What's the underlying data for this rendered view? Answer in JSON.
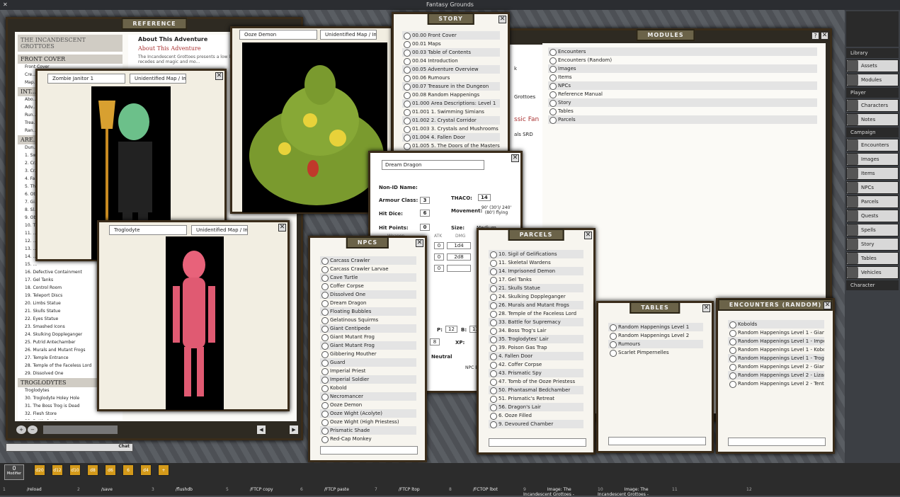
{
  "app": {
    "title": "Fantasy Grounds"
  },
  "reference": {
    "title": "Reference",
    "book_title": "The Incandescent Grottoes",
    "front_cover": "Front Cover",
    "front_items": [
      "Front Cover",
      "Cre...",
      "Map..."
    ],
    "about_title": "About This Adventure",
    "about_sub": "About This Adventure",
    "about_text": "The Incandescent Grottoes presents a low level surface world's logic recedes and magic and mo...",
    "section_int": "Int...",
    "int_items": [
      "Abo...",
      "Adv...",
      "Run...",
      "Trea...",
      "Ran..."
    ],
    "section_are": "Are...",
    "are_items": [
      "Dun...",
      "1. Sw...",
      "2. Cr...",
      "3. Cr...",
      "4. Fa...",
      "5. Th...",
      "6. Ot...",
      "7. Gi...",
      "8. Sl...",
      "9. Ob...",
      "10. T...",
      "11. ...",
      "12. ...",
      "13. ...",
      "14. ...",
      "15. ..."
    ],
    "more_items": [
      "16. Defective Containment",
      "17. Gel Tanks",
      "18. Control Room",
      "19. Teleport Discs",
      "20. Limbs Statue",
      "21. Skulls Statue",
      "22. Eyes Statue",
      "23. Smashed Icons",
      "24. Skulking Doppleganger",
      "25. Putrid Antechamber",
      "26. Murals and Mutant Frogs",
      "27. Temple Entrance",
      "28. Temple of the Faceless Lord",
      "29. Dissolved One"
    ],
    "section_trog": "Troglodytes",
    "trog_items": [
      "Troglodytes",
      "30. Troglodyte Holey Hole",
      "31. The Boss Trog is Dead",
      "32. Flesh Store",
      "33. Bottle for Supremacy"
    ]
  },
  "zombie": {
    "name": "Zombie Janitor 1",
    "image": "Unidentified Map / Imag"
  },
  "trog": {
    "name": "Troglodyte",
    "image": "Unidentified Map / Imag"
  },
  "ooze": {
    "name": "Ooze Demon",
    "image": "Unidentified Map / Imag"
  },
  "story": {
    "title": "Story",
    "items": [
      "00.00 Front Cover",
      "00.01 Maps",
      "00.03 Table of Contents",
      "00.04 Introduction",
      "00.05 Adventure Overview",
      "00.06 Rumours",
      "00.07 Treasure in the Dungeon",
      "00.08 Random Happenings",
      "01.000 Area Descriptions: Level 1",
      "01.001 1. Swimming Simians",
      "01.002 2. Crystal Corridor",
      "01.003 3. Crystals and Mushrooms",
      "01.004 4. Fallen Door",
      "01.005 5. The Doors of the Masters"
    ]
  },
  "modules": {
    "title": "Modules",
    "items": [
      "Encounters",
      "Encounters (Random)",
      "Images",
      "Items",
      "NPCs",
      "Reference Manual",
      "Story",
      "Tables",
      "Parcels"
    ],
    "peek": [
      "k",
      "Grottoes",
      "ssic Fan",
      "als SRD"
    ]
  },
  "npc_sheet": {
    "name": "Dream Dragon",
    "nonid_label": "Non-ID Name:",
    "ac_label": "Armour Class:",
    "ac": "3",
    "thaco_label": "THACO:",
    "thaco": "14",
    "hd_label": "Hit Dice:",
    "hd": "6",
    "move_label": "Movement:",
    "move": "90' (30')/ 240' (80') flying",
    "hp_label": "Hit Points:",
    "hp": "0",
    "size_label": "Size:",
    "size": "Medium",
    "weapon_label": "Weapon",
    "atk_label": "ATK",
    "dmg_label": "DMG",
    "atk1": "0",
    "dmg1": "1d4",
    "atk2": "0",
    "dmg2": "2d8",
    "atk3": "0",
    "p_label": "P:",
    "p": "12",
    "b_label": "B:",
    "b": "13",
    "xp_label": "XP:",
    "lvl": "8",
    "align": "Neutral",
    "npc_label": "NPC Ef"
  },
  "npcs": {
    "title": "NPCs",
    "items": [
      "Carcass Crawler",
      "Carcass Crawler Larvae",
      "Cave Turtle",
      "Coffer Corpse",
      "Dissolved One",
      "Dream Dragon",
      "Floating Bubbles",
      "Gelatinous Squirms",
      "Giant Centipede",
      "Giant Mutant Frog",
      "Giant Mutant Frog",
      "Gibbering Mouther",
      "Guard",
      "Imperial Priest",
      "Imperial Soldier",
      "Kobold",
      "Necromancer",
      "Ooze Demon",
      "Ooze Wight (Acolyte)",
      "Ooze Wight (High Priestess)",
      "Prismatic Shade",
      "Red-Cap Monkey"
    ]
  },
  "parcels": {
    "title": "Parcels",
    "items": [
      "10. Sigil of Gelifications",
      "11. Skeletal Wardens",
      "14. Imprisoned Demon",
      "17. Gel Tanks",
      "21. Skulls Statue",
      "24. Skulking Doppleganger",
      "26. Murals and Mutant Frogs",
      "28. Temple of the Faceless Lord",
      "33. Battle for Supremacy",
      "34. Boss Trog's Lair",
      "35. Troglodytes' Lair",
      "39. Poison Gas Trap",
      "4. Fallen Door",
      "42. Coffer Corpse",
      "43. Prismatic Spy",
      "47. Tomb of the Ooze Priestess",
      "50. Phantasmal Bedchamber",
      "51. Prismatic's Retreat",
      "56. Dragon's Lair",
      "6. Ooze Filled",
      "9. Devoured Chamber"
    ]
  },
  "tables": {
    "title": "Tables",
    "items": [
      "Random Happenings Level 1",
      "Random Happenings Level 2",
      "Rumours",
      "Scarlet Pimpernelles"
    ]
  },
  "encounters": {
    "title": "Encounters (Random)",
    "items": [
      "Kobolds",
      "Random Happenings Level 1 - Giant Centiped",
      "Random Happenings Level 1 - Imperial Soldie",
      "Random Happenings Level 1 - Kobolds",
      "Random Happenings Level 1 - Troglodytes",
      "Random Happenings Level 2 - Giant Mutant F",
      "Random Happenings Level 2 - Lizard Men",
      "Random Happenings Level 2 - Tentacles"
    ]
  },
  "sidebar": {
    "library": "Library",
    "assets": "Assets",
    "modules": "Modules",
    "player": "Player",
    "characters": "Characters",
    "notes": "Notes",
    "campaign": "Campaign",
    "campaign_items": [
      "Encounters",
      "Images",
      "Items",
      "NPCs",
      "Parcels",
      "Quests",
      "Spells",
      "Story",
      "Tables",
      "Vehicles"
    ],
    "character": "Character"
  },
  "chat": {
    "label": "Chat",
    "modifier": "0",
    "modifier_label": "Modifier"
  },
  "dice": [
    "d20",
    "d12",
    "d10",
    "d8",
    "d6",
    "6",
    "d4",
    "+"
  ],
  "hotkeys": [
    {
      "n": "1",
      "t": "/reload"
    },
    {
      "n": "2",
      "t": "/save"
    },
    {
      "n": "3",
      "t": "/flushdb"
    },
    {
      "n": "5",
      "t": "/FTCP copy"
    },
    {
      "n": "6",
      "t": "/FTCP paste"
    },
    {
      "n": "7",
      "t": "/FTCP ltop"
    },
    {
      "n": "8",
      "t": "/FCTOP lbot"
    },
    {
      "n": "9",
      "t": "Image: The Incandescent Grottoes -"
    },
    {
      "n": "10",
      "t": "Image: The Incandescent Grottoes -"
    },
    {
      "n": "11",
      "t": ""
    },
    {
      "n": "12",
      "t": ""
    }
  ]
}
